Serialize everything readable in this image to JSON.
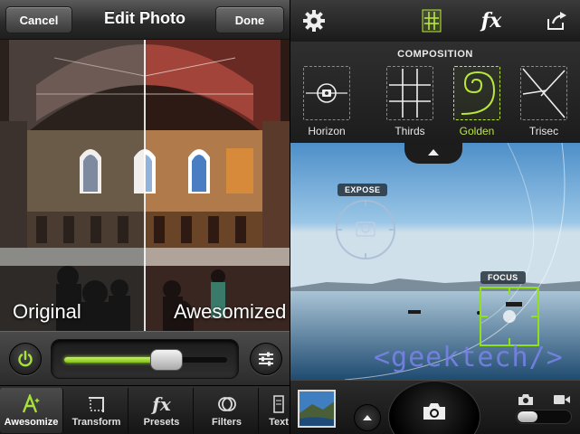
{
  "left": {
    "nav": {
      "cancel": "Cancel",
      "title": "Edit Photo",
      "done": "Done"
    },
    "photo": {
      "left_label": "Original",
      "right_label": "Awesomized"
    },
    "slider": {
      "value": 0.63
    },
    "tabs": [
      {
        "label": "Awesomize",
        "icon": "awesomize-icon",
        "active": true
      },
      {
        "label": "Transform",
        "icon": "crop-icon",
        "active": false
      },
      {
        "label": "Presets",
        "icon": "fx-icon",
        "active": false
      },
      {
        "label": "Filters",
        "icon": "filters-icon",
        "active": false
      },
      {
        "label": "Text",
        "icon": "text-icon",
        "active": false
      }
    ],
    "colors": {
      "accent": "#a6e23a"
    }
  },
  "right": {
    "top": {
      "fx": "fx"
    },
    "composition": {
      "title": "COMPOSITION",
      "options": [
        {
          "label": "Horizon",
          "active": false
        },
        {
          "label": "Thirds",
          "active": false
        },
        {
          "label": "Golden",
          "active": true
        },
        {
          "label": "Trisec",
          "active": false
        }
      ]
    },
    "viewfinder": {
      "expose": "EXPOSE",
      "focus": "FOCUS",
      "watermark": "<geektech/>"
    },
    "colors": {
      "accent": "#b9e83a"
    }
  }
}
